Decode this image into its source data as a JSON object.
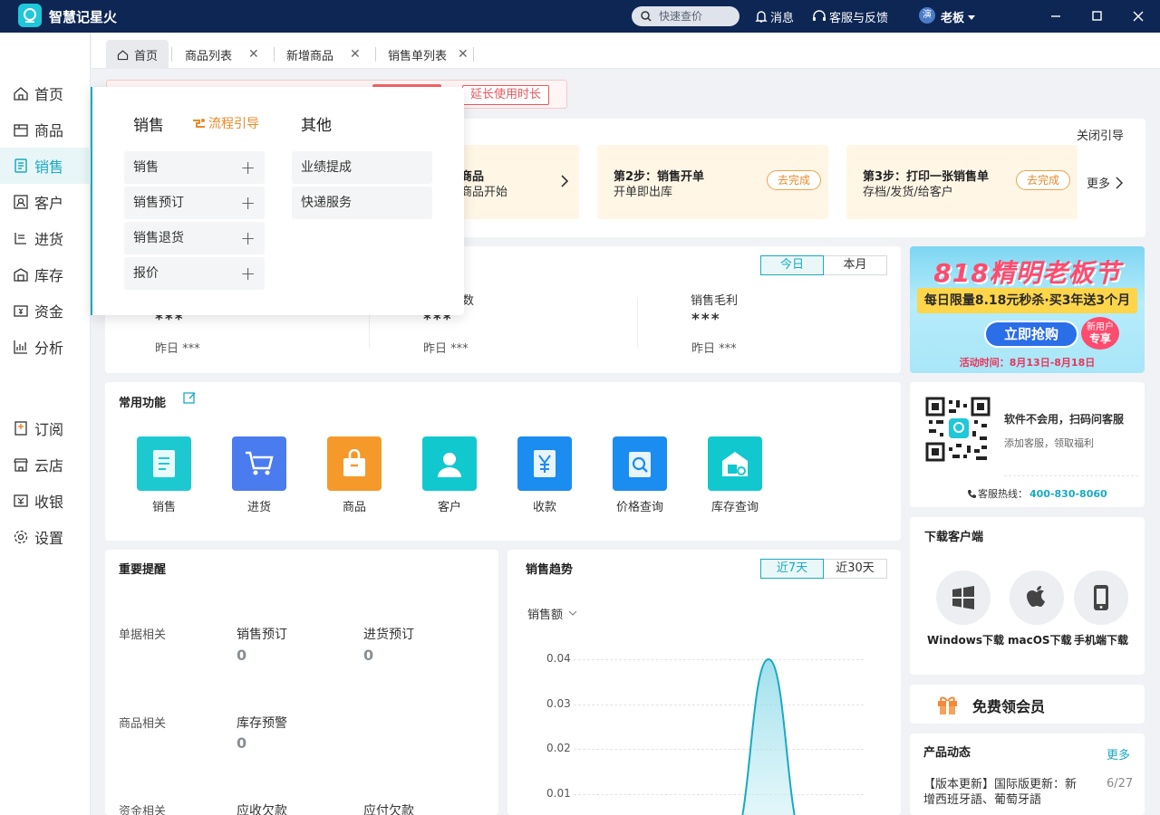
{
  "app": {
    "title": "智慧记星火"
  },
  "topbar": {
    "search_placeholder": "快速查价",
    "messages": "消息",
    "support": "客服与反馈",
    "user_avatar": "演",
    "user_name": "老板"
  },
  "sidebar": {
    "items": [
      {
        "label": "首页",
        "icon": "home-icon"
      },
      {
        "label": "商品",
        "icon": "box-icon"
      },
      {
        "label": "销售",
        "icon": "clipboard-icon",
        "active": true
      },
      {
        "label": "客户",
        "icon": "contact-icon"
      },
      {
        "label": "进货",
        "icon": "purchase-icon"
      },
      {
        "label": "库存",
        "icon": "warehouse-icon"
      },
      {
        "label": "资金",
        "icon": "wallet-icon"
      },
      {
        "label": "分析",
        "icon": "chart-icon"
      },
      {
        "label": "订阅",
        "icon": "subscribe-icon"
      },
      {
        "label": "云店",
        "icon": "store-icon"
      },
      {
        "label": "收银",
        "icon": "cashier-icon"
      },
      {
        "label": "设置",
        "icon": "gear-icon"
      }
    ]
  },
  "tabs": [
    {
      "label": "首页",
      "active": true
    },
    {
      "label": "商品列表"
    },
    {
      "label": "新增商品"
    },
    {
      "label": "销售单列表"
    }
  ],
  "notice": {
    "extend_button": "延长使用时长"
  },
  "guide": {
    "close_label": "关闭引导",
    "step1_title": "商品",
    "step1_sub": "商品开始",
    "step2_title": "第2步：销售开单",
    "step2_sub": "开单即出库",
    "step2_btn": "去完成",
    "step3_title": "第3步：打印一张销售单",
    "step3_sub": "存档/发货/给客户",
    "step3_btn": "去完成",
    "more": "更多"
  },
  "sales": {
    "toggle": [
      "今日",
      "本月"
    ],
    "col2_label": "数",
    "col3_label": "销售毛利",
    "values": [
      "***",
      "***",
      "***"
    ],
    "yesterday": [
      "昨日 ***",
      "昨日 ***",
      "昨日 ***"
    ]
  },
  "functions": {
    "title": "常用功能",
    "items": [
      {
        "label": "销售",
        "icon": "sales-doc-icon",
        "color": "#1dc9d1"
      },
      {
        "label": "进货",
        "icon": "cart-icon",
        "color": "#4a7cf0"
      },
      {
        "label": "商品",
        "icon": "bag-icon",
        "color": "#f59a2a"
      },
      {
        "label": "客户",
        "icon": "person-icon",
        "color": "#12c8cf"
      },
      {
        "label": "收款",
        "icon": "yen-icon",
        "color": "#1b8cf0"
      },
      {
        "label": "价格查询",
        "icon": "price-search-icon",
        "color": "#1b8cf0"
      },
      {
        "label": "库存查询",
        "icon": "stock-search-icon",
        "color": "#12c8cf"
      }
    ]
  },
  "reminders": {
    "title": "重要提醒",
    "groups": [
      {
        "name": "单据相关",
        "items": [
          {
            "label": "销售预订",
            "value": "0"
          },
          {
            "label": "进货预订",
            "value": "0"
          }
        ]
      },
      {
        "name": "商品相关",
        "items": [
          {
            "label": "库存预警",
            "value": "0"
          }
        ]
      },
      {
        "name": "资金相关",
        "items": [
          {
            "label": "应收欠款",
            "value": ""
          },
          {
            "label": "应付欠款",
            "value": ""
          }
        ]
      }
    ]
  },
  "trend": {
    "title": "销售趋势",
    "toggle": [
      "近7天",
      "近30天"
    ],
    "metric": "销售额"
  },
  "chart_data": {
    "type": "area",
    "ylabel": "销售额",
    "y_ticks": [
      "0.04",
      "0.03",
      "0.02",
      "0.01"
    ],
    "ylim": [
      0,
      0.04
    ],
    "series": [
      {
        "values": [
          0,
          0,
          0.04,
          0,
          0
        ]
      }
    ],
    "color": "#1aa9c2"
  },
  "promo": {
    "headline": "818精明老板节",
    "subline": "每日限量8.18元秒杀·买3年送3个月",
    "button": "立即抢购",
    "badge_line1": "新用户",
    "badge_line2": "专享",
    "date": "活动时间：8月13日-8月18日"
  },
  "service": {
    "title": "软件不会用，扫码问客服",
    "sub": "添加客服，领取福利",
    "hotline_label": "客服热线：",
    "hotline": "400-830-8060"
  },
  "download": {
    "title": "下载客户端",
    "items": [
      {
        "label": "Windows下载",
        "icon": "windows-icon"
      },
      {
        "label": "macOS下载",
        "icon": "apple-icon"
      },
      {
        "label": "手机端下载",
        "icon": "phone-icon"
      }
    ]
  },
  "member": {
    "label": "免费领会员"
  },
  "news": {
    "title": "产品动态",
    "more": "更多",
    "item_line1": "【版本更新】国际版更新：新",
    "item_line2": "增西班牙語、葡萄牙語",
    "item_date": "6/27"
  },
  "dropdown": {
    "col1_title": "销售",
    "flow_guide": "流程引导",
    "col1_items": [
      "销售",
      "销售预订",
      "销售退货",
      "报价"
    ],
    "col2_title": "其他",
    "col2_items": [
      "业绩提成",
      "快递服务"
    ]
  }
}
